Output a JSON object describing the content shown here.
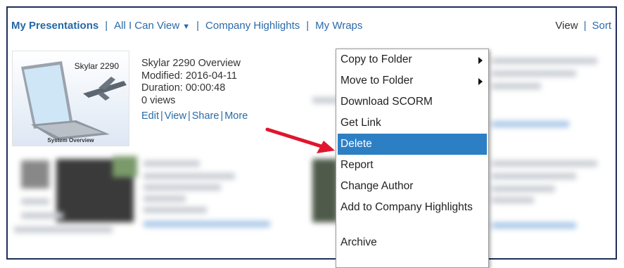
{
  "nav": {
    "my_presentations": "My Presentations",
    "all_i_can_view": "All I Can View",
    "company_highlights": "Company Highlights",
    "my_wraps": "My Wraps",
    "view": "View",
    "sort": "Sort",
    "separator": "|"
  },
  "presentation": {
    "thumb_title": "Skylar 2290",
    "thumb_subtitle": "System Overview",
    "title": "Skylar 2290 Overview",
    "modified": "Modified: 2016-04-11",
    "duration": "Duration: 00:00:48",
    "views": "0 views",
    "links": {
      "edit": "Edit",
      "view": "View",
      "share": "Share",
      "more": "More"
    }
  },
  "context_menu": {
    "items": [
      {
        "label": "Copy to Folder",
        "submenu": true
      },
      {
        "label": "Move to Folder",
        "submenu": true
      },
      {
        "label": "Download SCORM",
        "submenu": false
      },
      {
        "label": "Get Link",
        "submenu": false
      },
      {
        "label": "Delete",
        "submenu": false,
        "selected": true
      },
      {
        "label": "Report",
        "submenu": false
      },
      {
        "label": "Change Author",
        "submenu": false
      },
      {
        "label": "Add to Company Highlights",
        "submenu": false
      },
      {
        "label": "Archive",
        "submenu": false
      }
    ]
  },
  "colors": {
    "link": "#2a6aa8",
    "selection": "#2d7fc4",
    "annotation_arrow": "#e0152e",
    "frame": "#1f2d5a"
  }
}
